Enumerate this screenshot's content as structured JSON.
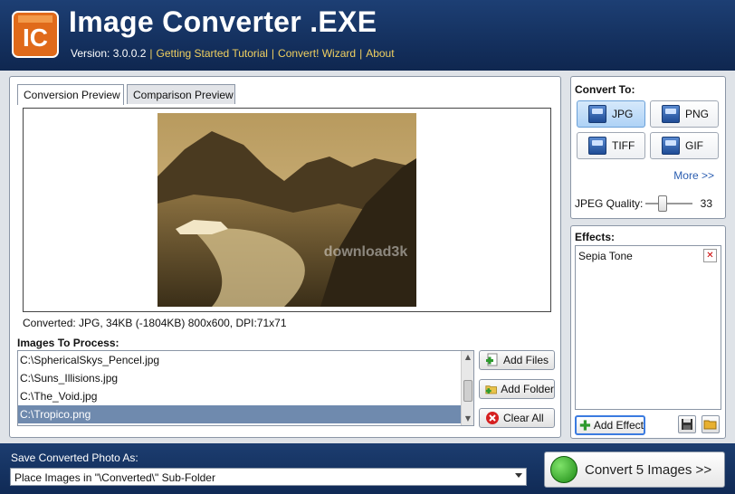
{
  "header": {
    "title": "Image Converter .EXE",
    "logo_text": "IC",
    "version": "Version: 3.0.0.2",
    "links": [
      "Getting Started Tutorial",
      "Convert! Wizard",
      "About"
    ]
  },
  "tabs": [
    "Conversion Preview",
    "Comparison Preview"
  ],
  "preview": {
    "info": "Converted: JPG, 34KB (-1804KB) 800x600, DPI:71x71",
    "watermark": "download3k"
  },
  "images": {
    "label": "Images To Process:",
    "files": [
      "C:\\SphericalSkys_Pencel.jpg",
      "C:\\Suns_Illisions.jpg",
      "C:\\The_Void.jpg",
      "C:\\Tropico.png"
    ],
    "selected_index": 3
  },
  "buttons": {
    "add_files": "Add Files",
    "add_folder": "Add Folder",
    "clear_all": "Clear All",
    "add_effect": "Add Effect",
    "convert": "Convert 5 Images >>"
  },
  "convert_to": {
    "label": "Convert To:",
    "formats": [
      "JPG",
      "PNG",
      "TIFF",
      "GIF"
    ],
    "selected": "JPG",
    "more": "More >>",
    "quality_label": "JPEG Quality:",
    "quality_value": "33",
    "quality_fraction": 0.33
  },
  "effects": {
    "label": "Effects:",
    "items": [
      "Sepia Tone"
    ]
  },
  "footer": {
    "save_label": "Save Converted Photo As:",
    "save_option": "Place Images in \"\\Converted\\\" Sub-Folder"
  },
  "colors": {
    "header_bg": "#14305e",
    "link": "#f0d060",
    "selected_row": "#6f8aae",
    "accent_blue": "#2a5db0"
  }
}
